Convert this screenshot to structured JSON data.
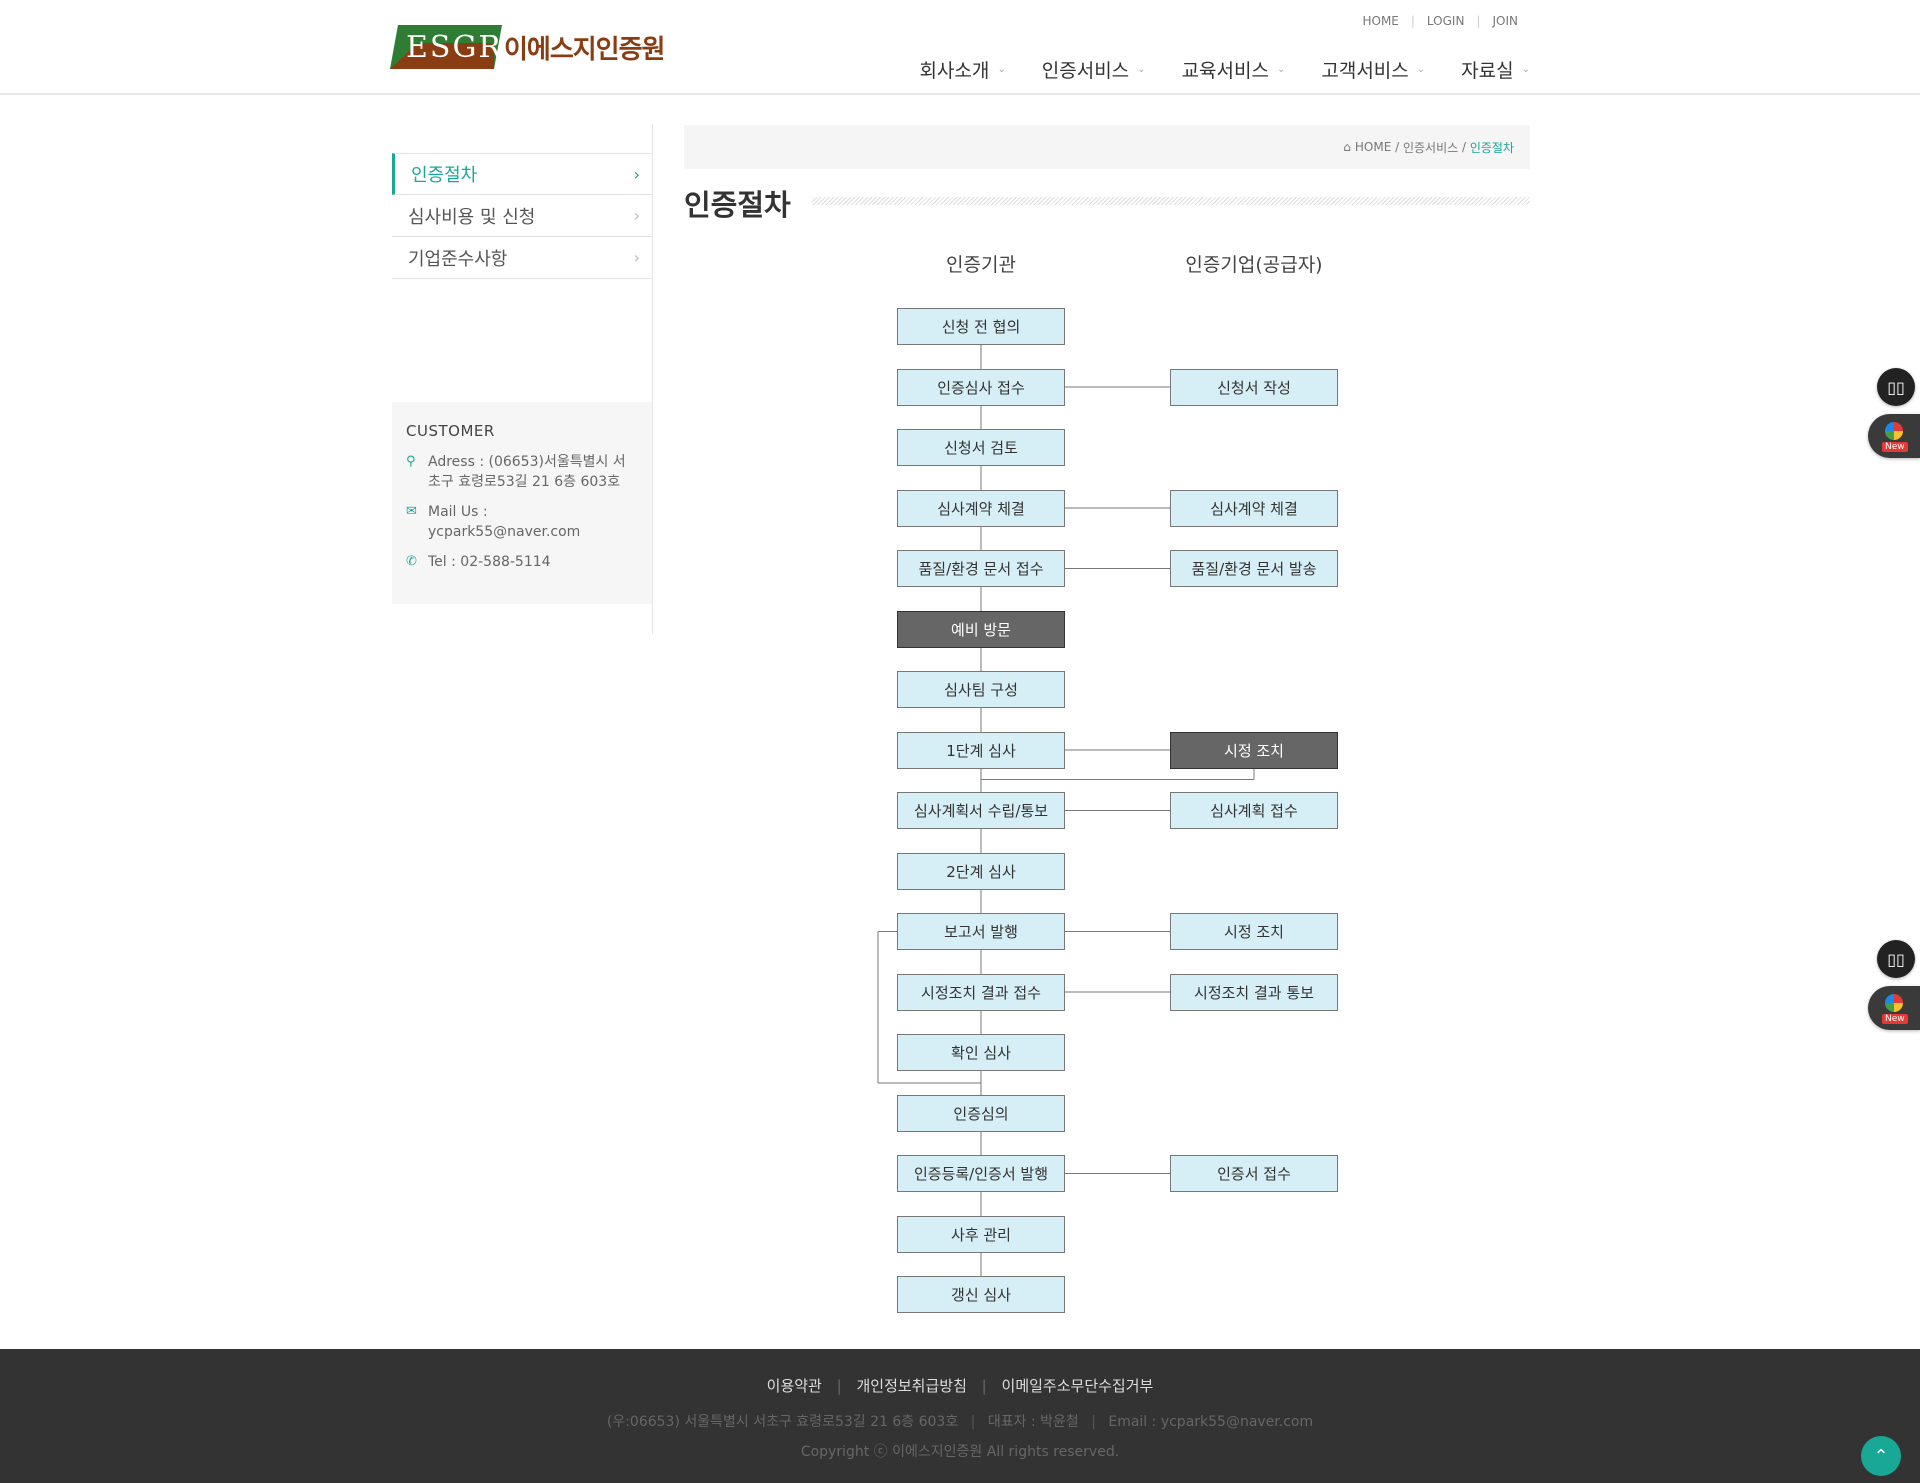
{
  "header": {
    "logo_mark": "ESGR",
    "logo_name": "이에스지인증원",
    "util": [
      "HOME",
      "LOGIN",
      "JOIN"
    ],
    "gnb": [
      "회사소개",
      "인증서비스",
      "교육서비스",
      "고객서비스",
      "자료실"
    ]
  },
  "sidebar": {
    "items": [
      {
        "label": "인증절차",
        "active": true
      },
      {
        "label": "심사비용 및 신청",
        "active": false
      },
      {
        "label": "기업준수사항",
        "active": false
      }
    ]
  },
  "customer": {
    "title": "CUSTOMER",
    "address": "Adress : (06653)서울특별시 서초구 효령로53길 21 6층 603호",
    "mail": "Mail Us : ycpark55@naver.com",
    "tel": "Tel : 02-588-5114"
  },
  "breadcrumb": {
    "home": "HOME",
    "section": "인증서비스",
    "current": "인증절차"
  },
  "page_title": "인증절차",
  "flow": {
    "col_left": "인증기관",
    "col_right": "인증기업(공급자)",
    "left_steps": [
      "신청 전 협의",
      "인증심사 접수",
      "신청서 검토",
      "심사계약 체결",
      "품질/환경 문서 접수",
      "예비 방문",
      "심사팀 구성",
      "1단계 심사",
      "심사계획서 수립/통보",
      "2단계 심사",
      "보고서 발행",
      "시정조치 결과 접수",
      "확인 심사",
      "인증심의",
      "인증등록/인증서 발행",
      "사후 관리",
      "갱신 심사"
    ],
    "right_steps": [
      {
        "row": 1,
        "label": "신청서 작성"
      },
      {
        "row": 3,
        "label": "심사계약 체결"
      },
      {
        "row": 4,
        "label": "품질/환경 문서 발송"
      },
      {
        "row": 7,
        "label": "시정 조치"
      },
      {
        "row": 8,
        "label": "심사계획 접수"
      },
      {
        "row": 10,
        "label": "시정 조치"
      },
      {
        "row": 11,
        "label": "시정조치 결과 통보"
      },
      {
        "row": 14,
        "label": "인증서 접수"
      }
    ],
    "dark_left_rows": [
      5
    ],
    "dark_right_rows": [
      7
    ]
  },
  "footer": {
    "links": [
      "이용약관",
      "개인정보취급방침",
      "이메일주소무단수집거부"
    ],
    "address": "(우:06653) 서울특별시 서초구 효령로53길 21 6층 603호",
    "ceo": "대표자 : 박윤철",
    "email": "Email : ycpark55@naver.com",
    "copyright": "Copyright ⓒ 이에스지인증원 All rights reserved."
  },
  "widgets": {
    "new_badge": "New"
  },
  "colors": {
    "accent": "#1aa896",
    "box_fill": "#d6eef5",
    "box_dark": "#666666",
    "footer_bg": "#333333",
    "logo_green": "#2e7d32",
    "logo_brown": "#8a3c12"
  }
}
